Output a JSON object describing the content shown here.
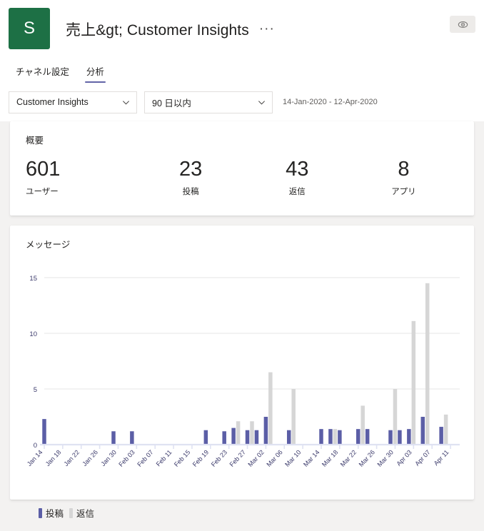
{
  "header": {
    "avatar_initial": "S",
    "title": "売上&gt; Customer Insights",
    "ellipsis": "···",
    "eye_icon": "eye-icon"
  },
  "tabs": [
    {
      "label": "チャネル設定",
      "active": false
    },
    {
      "label": "分析",
      "active": true
    }
  ],
  "filters": {
    "channel_select": {
      "value": "Customer Insights",
      "icon": "chevron-down-icon"
    },
    "period_select": {
      "value": "90 日以内",
      "icon": "chevron-down-icon"
    },
    "date_range": "14-Jan-2020 - 12-Apr-2020"
  },
  "summary": {
    "title": "概要",
    "stats": [
      {
        "value": "601",
        "label": "ユーザー"
      },
      {
        "value": "23",
        "label": "投稿"
      },
      {
        "value": "43",
        "label": "返信"
      },
      {
        "value": "8",
        "label": "アプリ"
      }
    ]
  },
  "messages_card": {
    "title": "メッセージ"
  },
  "colors": {
    "posts": "#5b5ea6",
    "replies": "#d6d6d6",
    "tab_accent": "#6264a7",
    "avatar_green": "#1d7045",
    "card_bg": "#ffffff",
    "page_bg": "#f3f2f1",
    "gridline": "#ededed",
    "axis": "#dfe2f2",
    "tick_label": "#3b3a6b"
  },
  "chart_data": {
    "type": "bar",
    "title": "メッセージ",
    "xlabel": "",
    "ylabel": "",
    "ylim": [
      0,
      15
    ],
    "yticks": [
      0,
      5,
      10,
      15
    ],
    "grid": true,
    "legend_position": "bottom-left",
    "legend": [
      {
        "name": "投稿",
        "color": "#5b5ea6"
      },
      {
        "name": "返信",
        "color": "#d6d6d6"
      }
    ],
    "x_tick_labels": [
      "Jan 14",
      "Jan 18",
      "Jan 22",
      "Jan 26",
      "Jan 30",
      "Feb 03",
      "Feb 07",
      "Feb 11",
      "Feb 15",
      "Feb 19",
      "Feb 23",
      "Feb 27",
      "Mar 02",
      "Mar 06",
      "Mar 10",
      "Mar 14",
      "Mar 18",
      "Mar 22",
      "Mar 26",
      "Mar 30",
      "Apr 03",
      "Apr 07",
      "Apr 11"
    ],
    "x_domain_days": 90,
    "x_start_date": "Jan 14",
    "x_end_date": "Apr 12",
    "series": [
      {
        "name": "投稿",
        "color": "#5b5ea6",
        "points": [
          {
            "day": 0,
            "value": 2.3
          },
          {
            "day": 15,
            "value": 1.2
          },
          {
            "day": 19,
            "value": 1.2
          },
          {
            "day": 35,
            "value": 1.3
          },
          {
            "day": 39,
            "value": 1.2
          },
          {
            "day": 41,
            "value": 1.5
          },
          {
            "day": 44,
            "value": 1.3
          },
          {
            "day": 46,
            "value": 1.3
          },
          {
            "day": 48,
            "value": 2.5
          },
          {
            "day": 53,
            "value": 1.3
          },
          {
            "day": 60,
            "value": 1.4
          },
          {
            "day": 62,
            "value": 1.4
          },
          {
            "day": 64,
            "value": 1.3
          },
          {
            "day": 68,
            "value": 1.4
          },
          {
            "day": 70,
            "value": 1.4
          },
          {
            "day": 75,
            "value": 1.3
          },
          {
            "day": 77,
            "value": 1.3
          },
          {
            "day": 79,
            "value": 1.4
          },
          {
            "day": 82,
            "value": 2.5
          },
          {
            "day": 86,
            "value": 1.6
          }
        ]
      },
      {
        "name": "返信",
        "color": "#d6d6d6",
        "points": [
          {
            "day": 42,
            "value": 2.1
          },
          {
            "day": 45,
            "value": 2.1
          },
          {
            "day": 49,
            "value": 6.5
          },
          {
            "day": 54,
            "value": 5.0
          },
          {
            "day": 63,
            "value": 1.4
          },
          {
            "day": 69,
            "value": 3.5
          },
          {
            "day": 76,
            "value": 5.0
          },
          {
            "day": 80,
            "value": 11.1
          },
          {
            "day": 83,
            "value": 14.5
          },
          {
            "day": 87,
            "value": 2.7
          }
        ]
      }
    ]
  }
}
